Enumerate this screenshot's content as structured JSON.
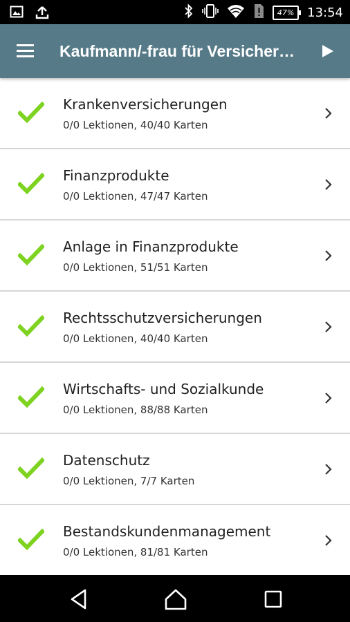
{
  "status_bar": {
    "time": "13:54",
    "battery": "47%",
    "left_icons": [
      "image-icon",
      "upload-icon"
    ],
    "right_icons": [
      "bluetooth-icon",
      "vibrate-icon",
      "wifi-icon",
      "sim-card-icon",
      "battery-icon"
    ]
  },
  "app_bar": {
    "title": "Kaufmann/-frau für Versicherungen und Finanzen",
    "background": "#567a87",
    "menu_icon": "hamburger-menu-icon",
    "action_icon": "play-icon"
  },
  "topics": [
    {
      "title": "Krankenversicherungen",
      "progress": "0/0 Lektionen, 40/40 Karten",
      "completed": true
    },
    {
      "title": "Finanzprodukte",
      "progress": "0/0 Lektionen, 47/47 Karten",
      "completed": true
    },
    {
      "title": "Anlage in Finanzprodukte",
      "progress": "0/0 Lektionen, 51/51 Karten",
      "completed": true
    },
    {
      "title": "Rechtsschutzversicherungen",
      "progress": "0/0 Lektionen, 40/40 Karten",
      "completed": true
    },
    {
      "title": "Wirtschafts- und Sozialkunde",
      "progress": "0/0 Lektionen, 88/88 Karten",
      "completed": true
    },
    {
      "title": "Datenschutz",
      "progress": "0/0 Lektionen, 7/7 Karten",
      "completed": true
    },
    {
      "title": "Bestandskundenmanagement",
      "progress": "0/0 Lektionen, 81/81 Karten",
      "completed": true
    }
  ],
  "colors": {
    "check": "#7ed321",
    "chevron": "#333333",
    "divider": "#d6d6d6"
  },
  "nav_bar": {
    "icons": [
      "back-icon",
      "home-icon",
      "recents-icon"
    ]
  }
}
